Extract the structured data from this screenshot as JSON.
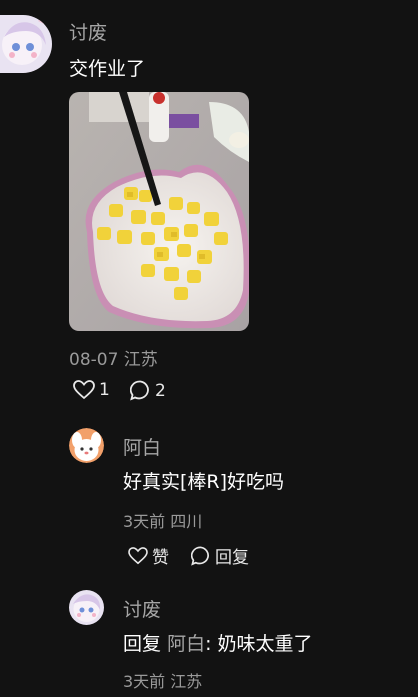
{
  "main_comment": {
    "username": "讨废",
    "text": "交作业了",
    "meta": "08-07 江苏",
    "likes": "1",
    "replies": "2",
    "image_icon": "food-photo"
  },
  "replies": [
    {
      "username": "阿白",
      "text": "好真实[棒R]好吃吗",
      "meta": "3天前 四川",
      "like_label": "赞",
      "reply_label": "回复"
    },
    {
      "username": "讨废",
      "reply_prefix": "回复",
      "reply_target": "阿白",
      "reply_sep": ": ",
      "text": "奶味太重了",
      "meta": "3天前 江苏"
    }
  ],
  "icons": {
    "heart": "heart-icon",
    "comment": "comment-bubble-icon"
  }
}
